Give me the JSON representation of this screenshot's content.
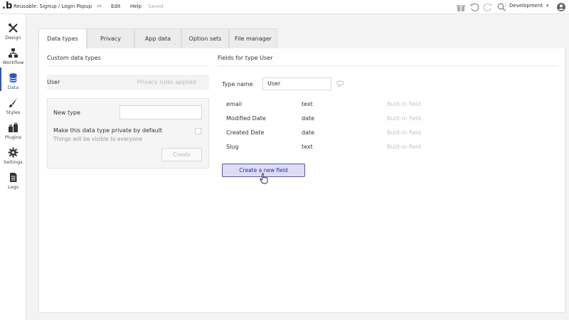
{
  "topbar": {
    "logo": ".b",
    "page_title": "Reusable: Signup / Login Popup",
    "title_arrow": "⇔",
    "edit": "Edit",
    "help": "Help",
    "saved": "Saved",
    "environment": "Development",
    "env_chevron": "▾",
    "icons": [
      "gift-icon",
      "undo-icon",
      "redo-icon",
      "search-icon",
      "account-icon"
    ]
  },
  "sidebar": {
    "items": [
      {
        "label": "Design",
        "icon": "design-icon"
      },
      {
        "label": "Workflow",
        "icon": "workflow-icon"
      },
      {
        "label": "Data",
        "icon": "data-icon",
        "active": true
      },
      {
        "label": "Styles",
        "icon": "styles-icon"
      },
      {
        "label": "Plugins",
        "icon": "plugins-icon"
      },
      {
        "label": "Settings",
        "icon": "settings-icon"
      },
      {
        "label": "Logs",
        "icon": "logs-icon"
      }
    ]
  },
  "tabs": [
    {
      "label": "Data types",
      "active": true
    },
    {
      "label": "Privacy"
    },
    {
      "label": "App data"
    },
    {
      "label": "Option sets"
    },
    {
      "label": "File manager"
    }
  ],
  "left": {
    "section_title": "Custom data types",
    "type_row": {
      "name": "User",
      "privacy": "Privacy rules applied"
    },
    "new_type_label": "New type",
    "new_type_value": "",
    "private_label": "Make this data type private by default",
    "private_sublabel": "Things will be visible to everyone",
    "create_button": "Create"
  },
  "right": {
    "section_title": "Fields for type User",
    "type_name_label": "Type name",
    "type_name_value": "User",
    "fields": [
      {
        "name": "email",
        "type": "text",
        "note": "Built-in field"
      },
      {
        "name": "Modified Date",
        "type": "date",
        "note": "Built-in field"
      },
      {
        "name": "Created Date",
        "type": "date",
        "note": "Built-in field"
      },
      {
        "name": "Slug",
        "type": "text",
        "note": "Built-in field"
      }
    ],
    "new_field_button": "Create a new field"
  },
  "colors": {
    "accent": "#2b56c9",
    "button_fill": "#dcdcf6",
    "button_border": "#5254c2"
  }
}
